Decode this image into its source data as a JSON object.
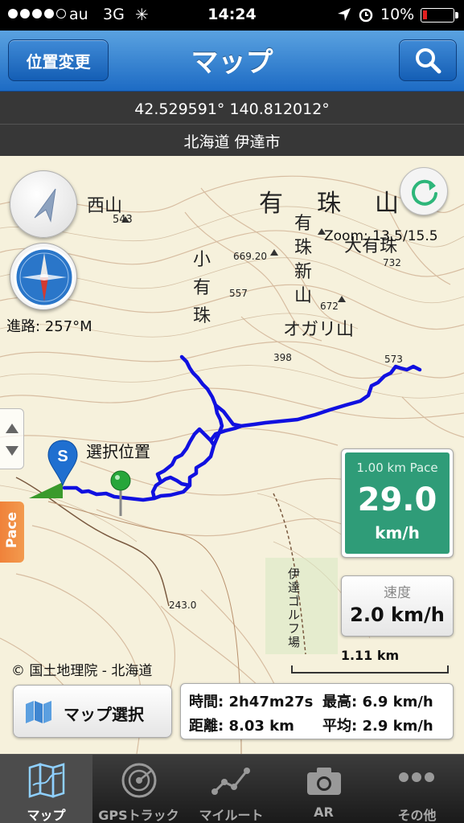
{
  "status_bar": {
    "carrier": "au",
    "network": "3G",
    "time": "14:24",
    "battery": "10%"
  },
  "nav": {
    "left_button": "位置変更",
    "title": "マップ"
  },
  "info": {
    "coordinates": "42.529591° 140.812012°",
    "place": "北海道 伊達市"
  },
  "map": {
    "labels": {
      "nishi_yama": "西山",
      "nishi_elev": "543",
      "usu_yama": "有　珠　山",
      "ko_usu": [
        "小",
        "有",
        "珠"
      ],
      "shin_zan": [
        "有",
        "珠",
        "新",
        "山"
      ],
      "oo_usu": "大有珠",
      "ogari": "オガリ山",
      "elev_669": "669.20",
      "elev_557": "557",
      "elev_672": "672",
      "elev_398": "398",
      "elev_573": "573",
      "elev_732": "732",
      "elev_243": "243.0",
      "golf": [
        "伊",
        "達",
        "ゴ",
        "ル",
        "フ",
        "場"
      ]
    },
    "zoom": "Zoom: 13.5/15.5",
    "heading": "進路: 257°M",
    "pace_tab": "Pace",
    "selected_position": "選択位置",
    "start_marker": "S",
    "pace": {
      "title": "1.00 km Pace",
      "value": "29.0",
      "unit": "km/h"
    },
    "speed": {
      "label": "速度",
      "value": "2.0 km/h"
    },
    "scale": "1.11 km",
    "copyright": "© 国土地理院 - 北海道",
    "map_select": "マップ選択",
    "stats": {
      "time": "時間: 2h47m27s",
      "max": "最高: 6.9 km/h",
      "distance": "距離: 8.03 km",
      "average": "平均: 2.9 km/h"
    },
    "colors": {
      "track": "#1010e0",
      "pace_bg": "#2f9c78",
      "contour": "#c9a98a",
      "accent": "#1d6bc4"
    }
  },
  "tabs": [
    {
      "label": "マップ",
      "icon": "map-icon",
      "active": true
    },
    {
      "label": "GPSトラック",
      "icon": "radar-icon",
      "active": false
    },
    {
      "label": "マイルート",
      "icon": "route-icon",
      "active": false
    },
    {
      "label": "AR",
      "icon": "camera-icon",
      "active": false
    },
    {
      "label": "その他",
      "icon": "more-icon",
      "active": false
    }
  ]
}
